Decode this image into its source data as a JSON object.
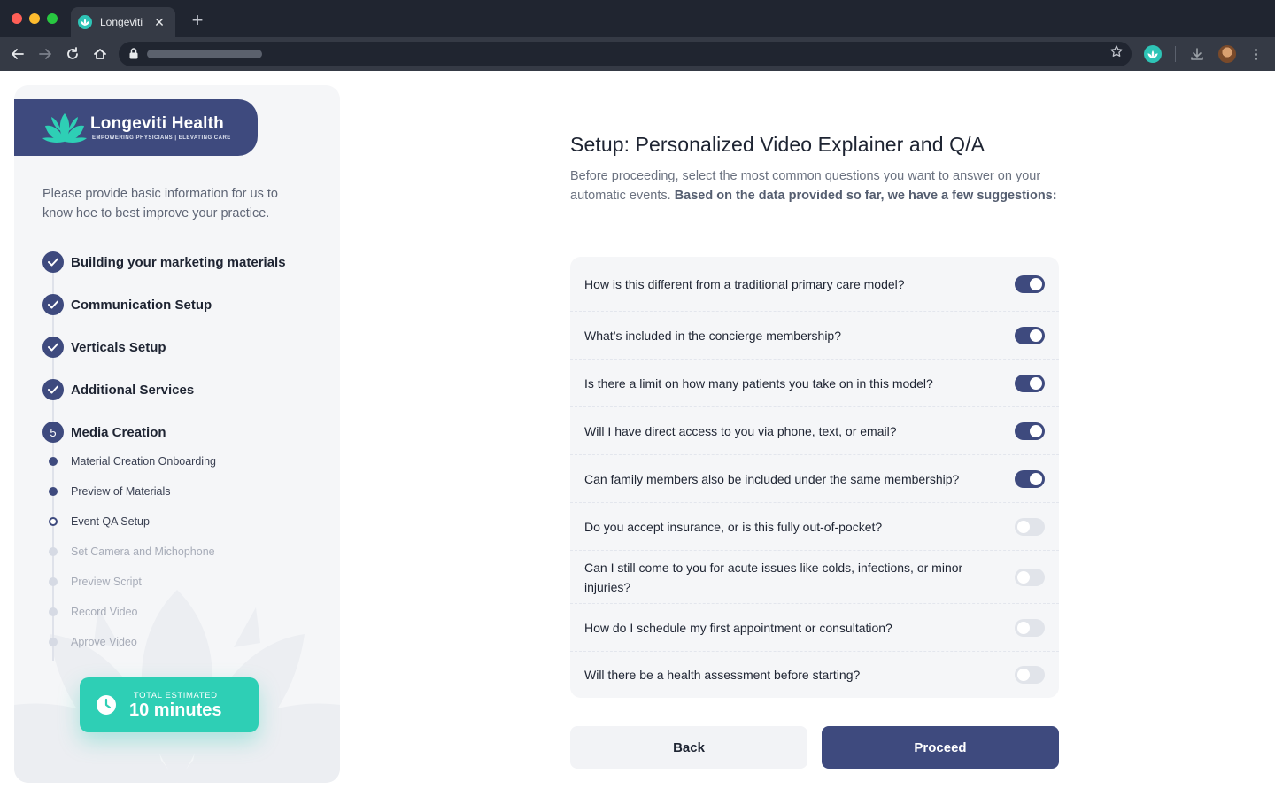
{
  "browser": {
    "tab_title": "Longeviti",
    "tab_close": "✕",
    "new_tab": "+"
  },
  "brand": {
    "name": "Longeviti Health",
    "tagline": "EMPOWERING PHYSICIANS | ELEVATING CARE"
  },
  "sidebar": {
    "intro": "Please provide basic information for us to know hoe to best improve your practice.",
    "steps": [
      {
        "label": "Building your marketing materials",
        "status": "done"
      },
      {
        "label": "Communication Setup",
        "status": "done"
      },
      {
        "label": "Verticals Setup",
        "status": "done"
      },
      {
        "label": "Additional Services",
        "status": "done"
      },
      {
        "label": "Media Creation",
        "status": "current",
        "number": "5"
      }
    ],
    "substeps": [
      {
        "label": "Material Creation Onboarding",
        "status": "done"
      },
      {
        "label": "Preview of Materials",
        "status": "done"
      },
      {
        "label": "Event QA Setup",
        "status": "current"
      },
      {
        "label": "Set Camera and Michophone",
        "status": "disabled"
      },
      {
        "label": "Preview Script",
        "status": "disabled"
      },
      {
        "label": "Record Video",
        "status": "disabled"
      },
      {
        "label": "Aprove Video",
        "status": "disabled"
      }
    ],
    "time_card": {
      "label": "TOTAL ESTIMATED",
      "value": "10 minutes"
    }
  },
  "main": {
    "title": "Setup: Personalized Video Explainer and Q/A",
    "desc_plain": "Before proceeding, select the most common questions you want to answer on your automatic events.",
    "desc_bold": "Based on the data provided so far, we have a few suggestions:",
    "questions": [
      {
        "text": "How is this different from a traditional primary care model?",
        "enabled": true
      },
      {
        "text": "What’s included in the concierge membership?",
        "enabled": true
      },
      {
        "text": "Is there a limit on how many patients you take on in this model?",
        "enabled": true
      },
      {
        "text": "Will I have direct access to you via phone, text, or email?",
        "enabled": true
      },
      {
        "text": "Can family members also be included under the same membership?",
        "enabled": true
      },
      {
        "text": "Do you accept insurance, or is this fully out-of-pocket?",
        "enabled": false
      },
      {
        "text": "Can I still come to you for acute issues like colds, infections, or minor injuries?",
        "enabled": false
      },
      {
        "text": "How do I schedule my first appointment or consultation?",
        "enabled": false
      },
      {
        "text": "Will there be a health assessment before starting?",
        "enabled": false
      }
    ],
    "back_label": "Back",
    "proceed_label": "Proceed"
  },
  "colors": {
    "primary": "#3e4a7e",
    "accent": "#2ecfb5",
    "panel": "#f5f6f8"
  }
}
